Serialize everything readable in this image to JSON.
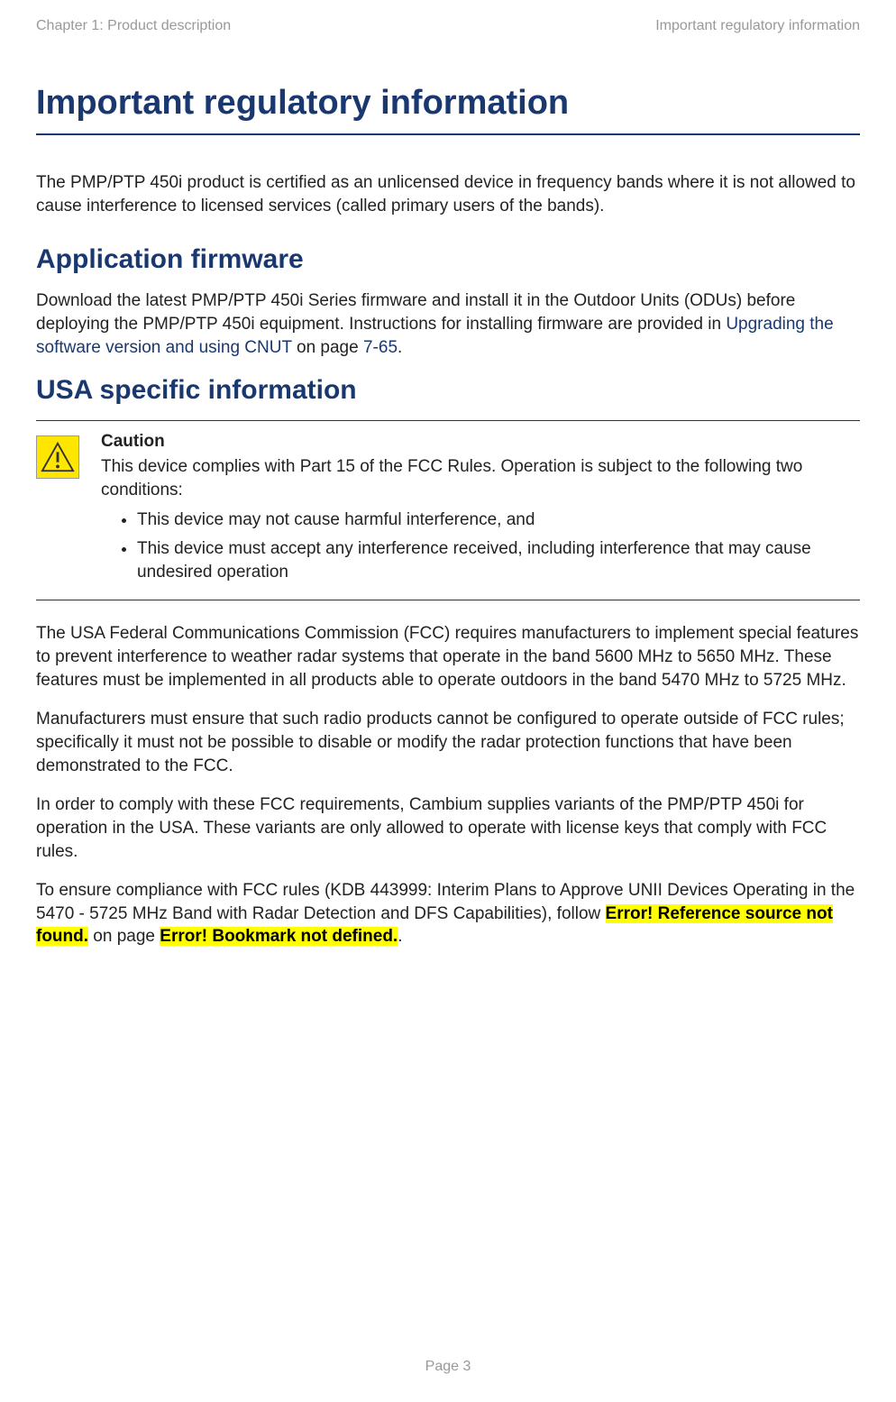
{
  "header": {
    "left": "Chapter 1:  Product description",
    "right": "Important regulatory information"
  },
  "title": "Important regulatory information",
  "intro": "The PMP/PTP 450i product is certified as an unlicensed device in frequency bands where it is not allowed to cause interference to licensed services (called primary users of the bands).",
  "sections": {
    "app_fw": {
      "heading": "Application firmware",
      "body_prefix": "Download the latest PMP/PTP 450i Series firmware and install it in the Outdoor Units (ODUs) before deploying the PMP/PTP 450i equipment. Instructions for installing firmware are provided in ",
      "link_text": "Upgrading the software version and using CNUT",
      "body_mid": " on page ",
      "page_ref": "7-65",
      "body_suffix": "."
    },
    "usa": {
      "heading": "USA specific information",
      "caution": {
        "label": "Caution",
        "intro": "This device complies with Part 15 of the FCC Rules. Operation is subject to the following two conditions:",
        "items": [
          "This device may not cause harmful interference, and",
          "This device must accept any interference received, including interference that may cause undesired operation"
        ]
      },
      "paras": [
        "The USA Federal Communications Commission (FCC) requires manufacturers to implement special features to prevent interference to weather radar systems that operate in the band 5600 MHz to 5650 MHz. These features must be implemented in all products able to operate outdoors in the band 5470 MHz to 5725 MHz.",
        "Manufacturers must ensure that such radio products cannot be configured to operate outside of FCC rules; specifically it must not be possible to disable or modify the radar protection functions that have been demonstrated to the FCC.",
        "In order to comply with these FCC requirements, Cambium supplies variants of the PMP/PTP 450i for operation in the USA. These variants are only allowed to operate with license keys that comply with FCC rules."
      ],
      "final_para": {
        "prefix": "To ensure compliance with FCC rules (KDB 443999: Interim Plans to Approve UNII Devices Operating in the 5470 - 5725 MHz Band with Radar Detection and DFS Capabilities), follow ",
        "error1": "Error! Reference source not found.",
        "mid": " on page ",
        "error2": "Error! Bookmark not defined.",
        "suffix": "."
      }
    }
  },
  "footer": "Page 3"
}
